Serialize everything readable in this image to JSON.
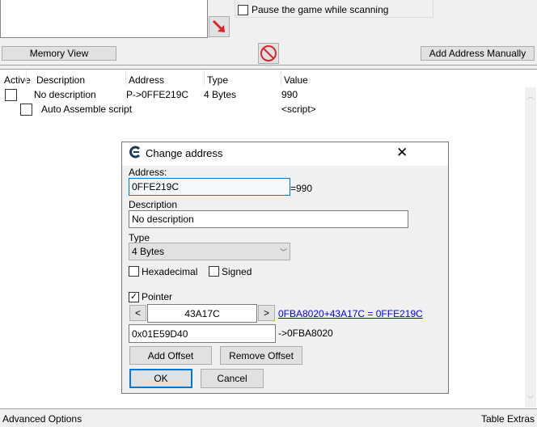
{
  "main": {
    "pause_label": "Pause the game while scanning",
    "memory_view": "Memory View",
    "add_address": "Add Address Manually",
    "columns": [
      "Active",
      "Description",
      "Address",
      "Type",
      "Value"
    ],
    "rows": [
      {
        "description": "No description",
        "address": "P->0FFE219C",
        "type": "4 Bytes",
        "value": "990"
      },
      {
        "description": "Auto Assemble script",
        "address": "",
        "type": "",
        "value": "<script>"
      }
    ],
    "advanced_options": "Advanced Options",
    "table_extras": "Table Extras"
  },
  "dialog": {
    "title": "Change address",
    "address_label": "Address:",
    "address_value": "0FFE219C",
    "address_result": "=990",
    "description_label": "Description",
    "description_value": "No description",
    "type_label": "Type",
    "type_value": "4 Bytes",
    "hex_label": "Hexadecimal",
    "signed_label": "Signed",
    "pointer_label": "Pointer",
    "pointer_checked": true,
    "prev": "<",
    "next": ">",
    "offset_value": "43A17C",
    "offset_link": "0FBA8020+43A17C = 0FFE219C",
    "base_value": "0x01E59D40",
    "base_result": "->0FBA8020",
    "add_offset": "Add Offset",
    "remove_offset": "Remove Offset",
    "ok": "OK",
    "cancel": "Cancel"
  },
  "colors": {
    "accent": "#0078d7",
    "link": "#0000ff",
    "arrow": "#d9262c"
  }
}
